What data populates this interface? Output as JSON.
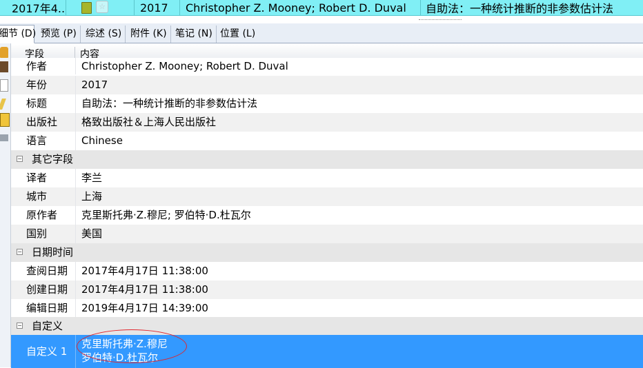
{
  "record_row": {
    "date": "2017年4...",
    "year": "2017",
    "authors": "Christopher Z. Mooney; Robert D. Duval",
    "title": "自助法：一种统计推断的非参数估计法"
  },
  "tabs": [
    {
      "label": "细节 (D)"
    },
    {
      "label": "预览 (P)"
    },
    {
      "label": "综述 (S)"
    },
    {
      "label": "附件 (K)"
    },
    {
      "label": "笔记 (N)"
    },
    {
      "label": "位置 (L)"
    }
  ],
  "grid": {
    "col_field": "字段",
    "col_content": "内容",
    "rows": [
      {
        "field": "作者",
        "value": "Christopher Z. Mooney; Robert D. Duval"
      },
      {
        "field": "年份",
        "value": "2017"
      },
      {
        "field": "标题",
        "value": "自助法：一种统计推断的非参数估计法"
      },
      {
        "field": "出版社",
        "value": "格致出版社＆上海人民出版社"
      },
      {
        "field": "语言",
        "value": "Chinese"
      }
    ],
    "group_other": "其它字段",
    "other_rows": [
      {
        "field": "译者",
        "value": "李兰"
      },
      {
        "field": "城市",
        "value": "上海"
      },
      {
        "field": "原作者",
        "value": "克里斯托弗·Z.穆尼; 罗伯特·D.杜瓦尔"
      },
      {
        "field": "国别",
        "value": "美国"
      }
    ],
    "group_date": "日期时间",
    "date_rows": [
      {
        "field": "查阅日期",
        "value": "2017年4月17日 11:38:00"
      },
      {
        "field": "创建日期",
        "value": "2017年4月17日 11:38:00"
      },
      {
        "field": "编辑日期",
        "value": "2019年4月17日 14:39:00"
      }
    ],
    "group_custom": "自定义",
    "custom_row": {
      "field": "自定义 1",
      "line1": "克里斯托弗·Z.穆尼",
      "line2": "罗伯特·D.杜瓦尔"
    }
  },
  "toggle_symbol": "⊟",
  "colors": {
    "selection": "#3399ff",
    "record_highlight": "#80eff5",
    "annotation": "#e0252c"
  }
}
